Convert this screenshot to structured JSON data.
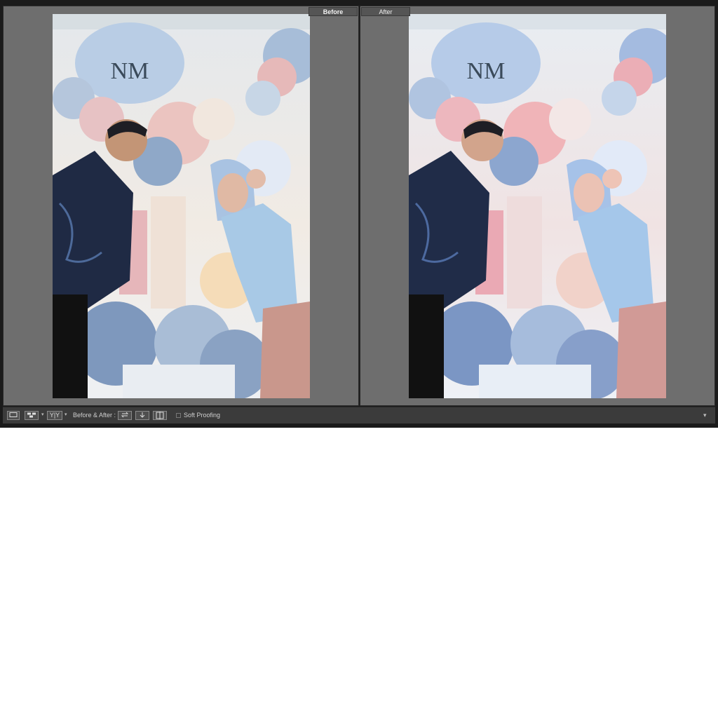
{
  "panes": {
    "before_label": "Before",
    "after_label": "After"
  },
  "photo": {
    "monogram": "NM"
  },
  "toolbar": {
    "loupe_view_icon": "loupe-view-icon",
    "survey_view_icon": "grid-view-icon",
    "compare_view_label": "Y|Y",
    "before_after_label": "Before & After :",
    "swap_icon": "swap-icon",
    "copy_before_icon": "copy-settings-icon",
    "copy_after_icon": "split-view-icon",
    "soft_proofing_label": "Soft Proofing",
    "soft_proofing_checked": false,
    "menu_icon": "dropdown-arrow-icon"
  },
  "colors": {
    "app_bg": "#1b1b1b",
    "pane_bg": "#6e6e6e",
    "toolbar_bg": "#3b3b3b"
  }
}
